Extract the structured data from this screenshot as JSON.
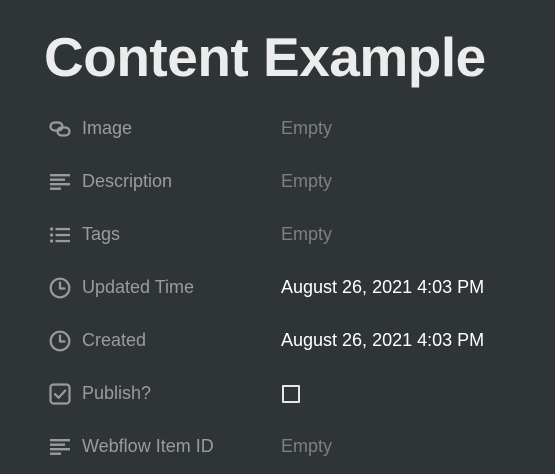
{
  "page": {
    "title": "Content Example"
  },
  "properties": [
    {
      "name": "Image",
      "icon": "link-icon",
      "value": "Empty",
      "empty": true
    },
    {
      "name": "Description",
      "icon": "text-lines-icon",
      "value": "Empty",
      "empty": true
    },
    {
      "name": "Tags",
      "icon": "list-icon",
      "value": "Empty",
      "empty": true
    },
    {
      "name": "Updated Time",
      "icon": "clock-icon",
      "value": "August 26, 2021 4:03 PM",
      "empty": false
    },
    {
      "name": "Created",
      "icon": "clock-icon",
      "value": "August 26, 2021 4:03 PM",
      "empty": false
    },
    {
      "name": "Publish?",
      "icon": "checkbox-icon",
      "checked": false
    },
    {
      "name": "Webflow Item ID",
      "icon": "text-lines-icon",
      "value": "Empty",
      "empty": true
    }
  ],
  "colors": {
    "background": "#2f3437",
    "title": "#ececec",
    "label": "#9b9b9b",
    "empty_value": "#7d7f81",
    "filled_value": "#ffffff"
  }
}
